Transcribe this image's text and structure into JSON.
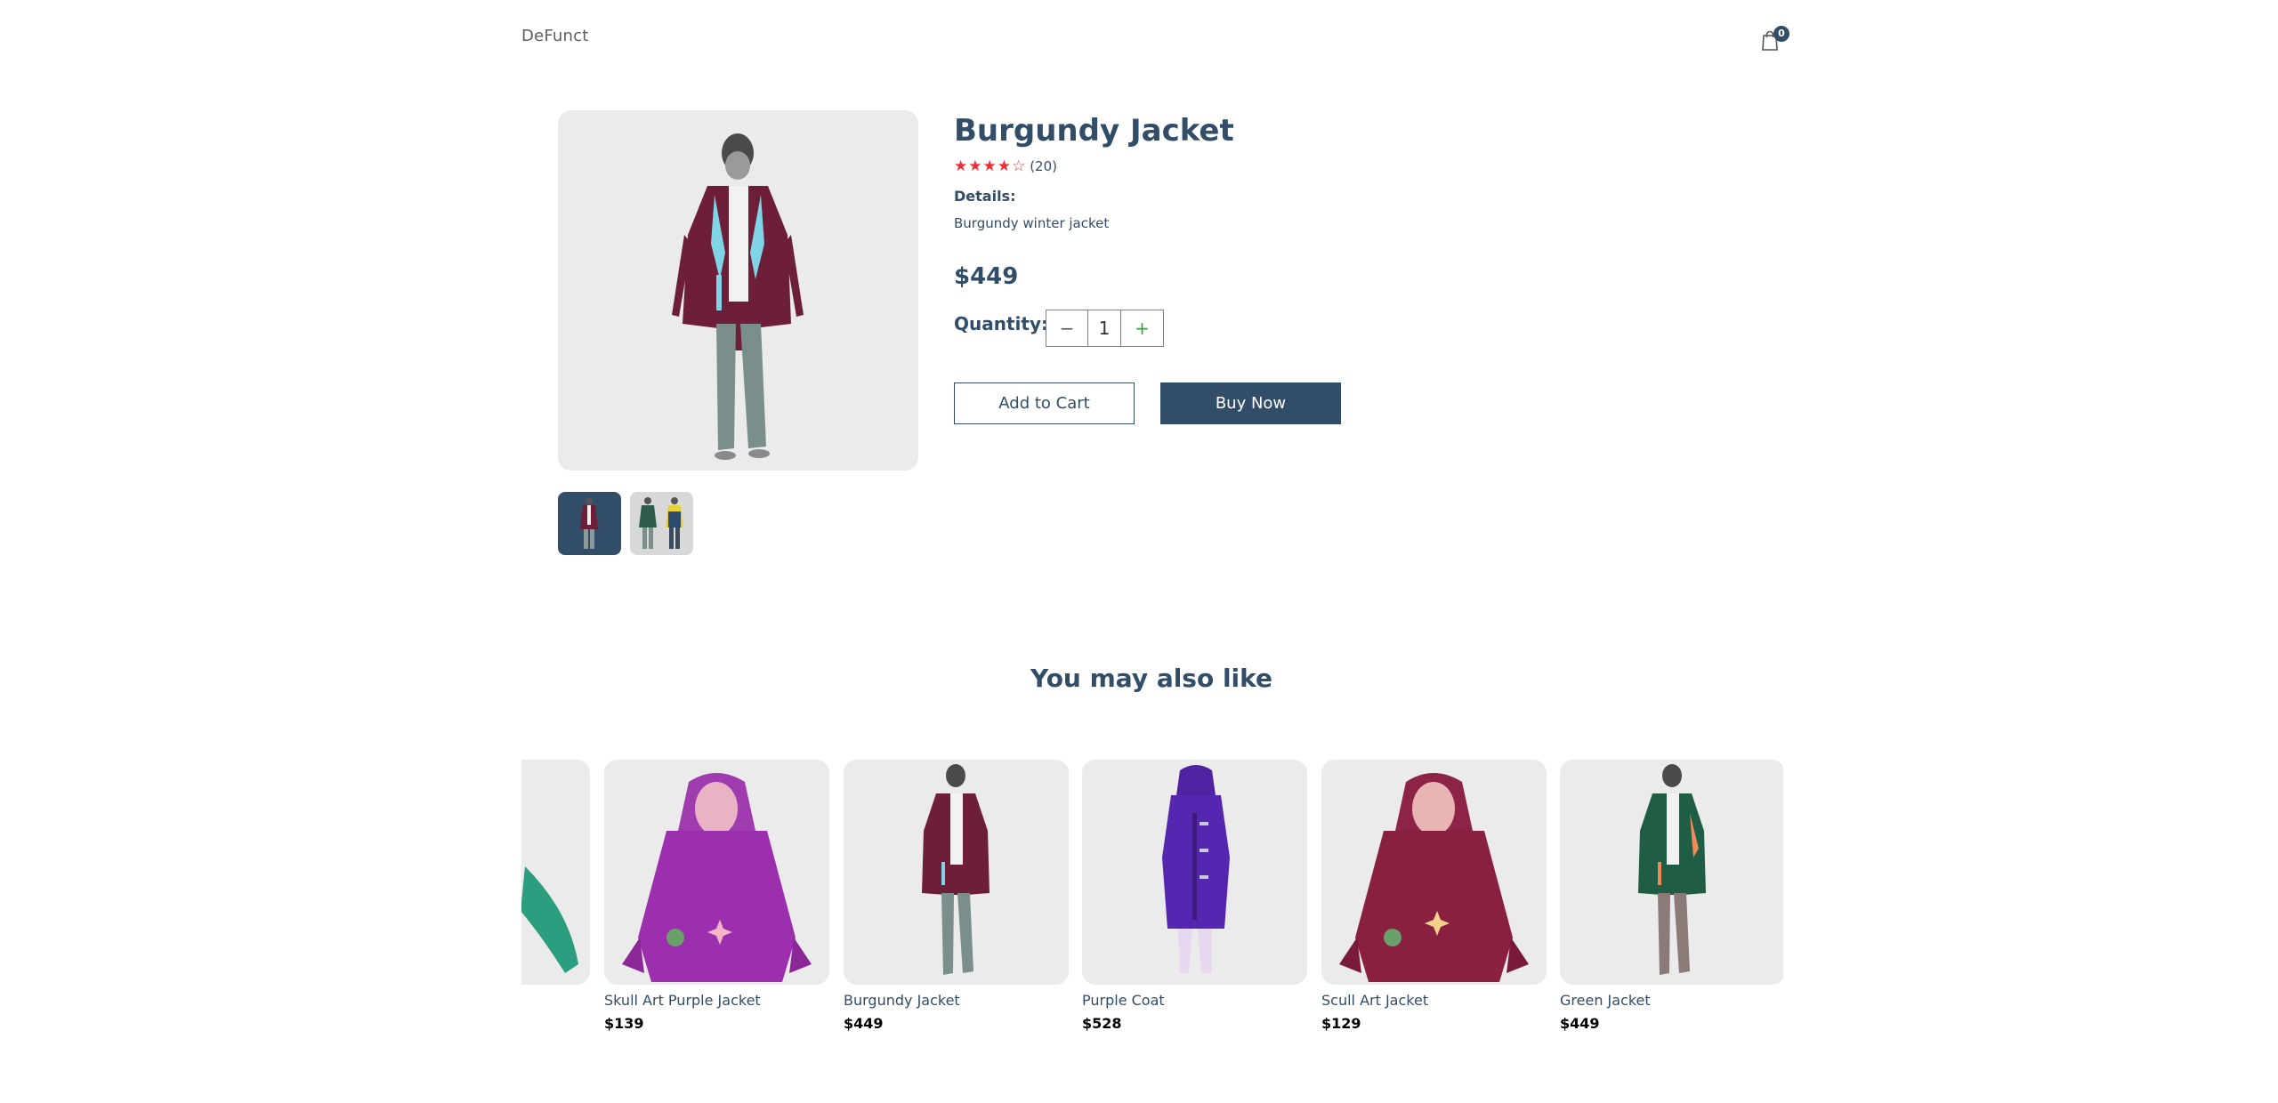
{
  "header": {
    "logo": "DeFunct",
    "cart_count": "0",
    "cart_icon": "shopping-bag-icon"
  },
  "product": {
    "name": "Burgundy Jacket",
    "stars": "★★★★☆",
    "rating_count": "(20)",
    "details_label": "Details:",
    "details": "Burgundy winter jacket",
    "price": "$449",
    "quantity_label": "Quantity:",
    "quantity": "1",
    "minus": "−",
    "plus": "+",
    "add_to_cart": "Add to Cart",
    "buy_now": "Buy Now"
  },
  "maylike": {
    "title": "You may also like",
    "items": [
      {
        "name": "Skull Art Purple Jacket",
        "price": "$139"
      },
      {
        "name": "Burgundy Jacket",
        "price": "$449"
      },
      {
        "name": "Purple Coat",
        "price": "$528"
      },
      {
        "name": "Scull Art Jacket",
        "price": "$129"
      },
      {
        "name": "Green Jacket",
        "price": "$449"
      }
    ]
  },
  "colors": {
    "primary": "#324d67",
    "accent_red": "#f02d34",
    "image_bg": "#ebebeb"
  }
}
